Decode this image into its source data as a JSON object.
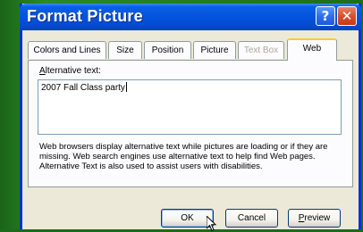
{
  "window": {
    "title": "Format Picture",
    "help_glyph": "?",
    "close_glyph": "✕"
  },
  "tabs": [
    {
      "label": "Colors and Lines",
      "state": "normal"
    },
    {
      "label": "Size",
      "state": "normal"
    },
    {
      "label": "Position",
      "state": "normal"
    },
    {
      "label": "Picture",
      "state": "normal"
    },
    {
      "label": "Text Box",
      "state": "disabled"
    },
    {
      "label": "Web",
      "state": "active"
    }
  ],
  "web_tab": {
    "alt_label": "Alternative text:",
    "alt_value": "2007 Fall Class party",
    "help_text": "Web browsers display alternative text while pictures are loading or if they are missing.  Web search engines use alternative text to help find Web pages.  Alternative Text is also used to assist users with disabilities."
  },
  "buttons": {
    "ok": "OK",
    "cancel": "Cancel",
    "preview": "Preview"
  },
  "colors": {
    "title_bar": "#0553dd",
    "close_button": "#d9512c",
    "dialog_face": "#ece9d8",
    "background": "#1d6e1b"
  }
}
